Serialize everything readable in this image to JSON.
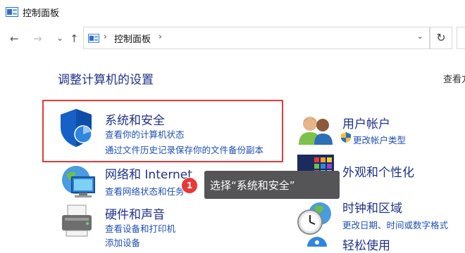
{
  "window": {
    "title": "控制面板"
  },
  "nav": {
    "back": "←",
    "forward": "→",
    "recent": "⌄",
    "up": "↑",
    "separator": "›",
    "crumb": "控制面板",
    "dropdown": "⌄",
    "refresh": "↻"
  },
  "main": {
    "heading": "调整计算机的设置",
    "view_by": "查看方式"
  },
  "categories": [
    {
      "title": "系统和安全",
      "links": [
        "查看你的计算机状态",
        "通过文件历史记录保存你的文件备份副本"
      ]
    },
    {
      "title": "网络和 Internet",
      "links": [
        "查看网络状态和任务"
      ]
    },
    {
      "title": "硬件和声音",
      "links": [
        "查看设备和打印机",
        "添加设备"
      ]
    },
    {
      "title": "用户帐户",
      "links": [
        "更改帐户类型"
      ]
    },
    {
      "title": "外观和个性化",
      "links": []
    },
    {
      "title": "时钟和区域",
      "links": [
        "更改日期、时间或数字格式"
      ]
    },
    {
      "title": "轻松使用",
      "links": []
    }
  ],
  "annotation": {
    "badge": "1",
    "tooltip": "选择“系统和安全”",
    "highlight_color": "#e23a3a"
  },
  "colors": {
    "category_title": "#1e3287",
    "link": "#1e4fb4"
  }
}
